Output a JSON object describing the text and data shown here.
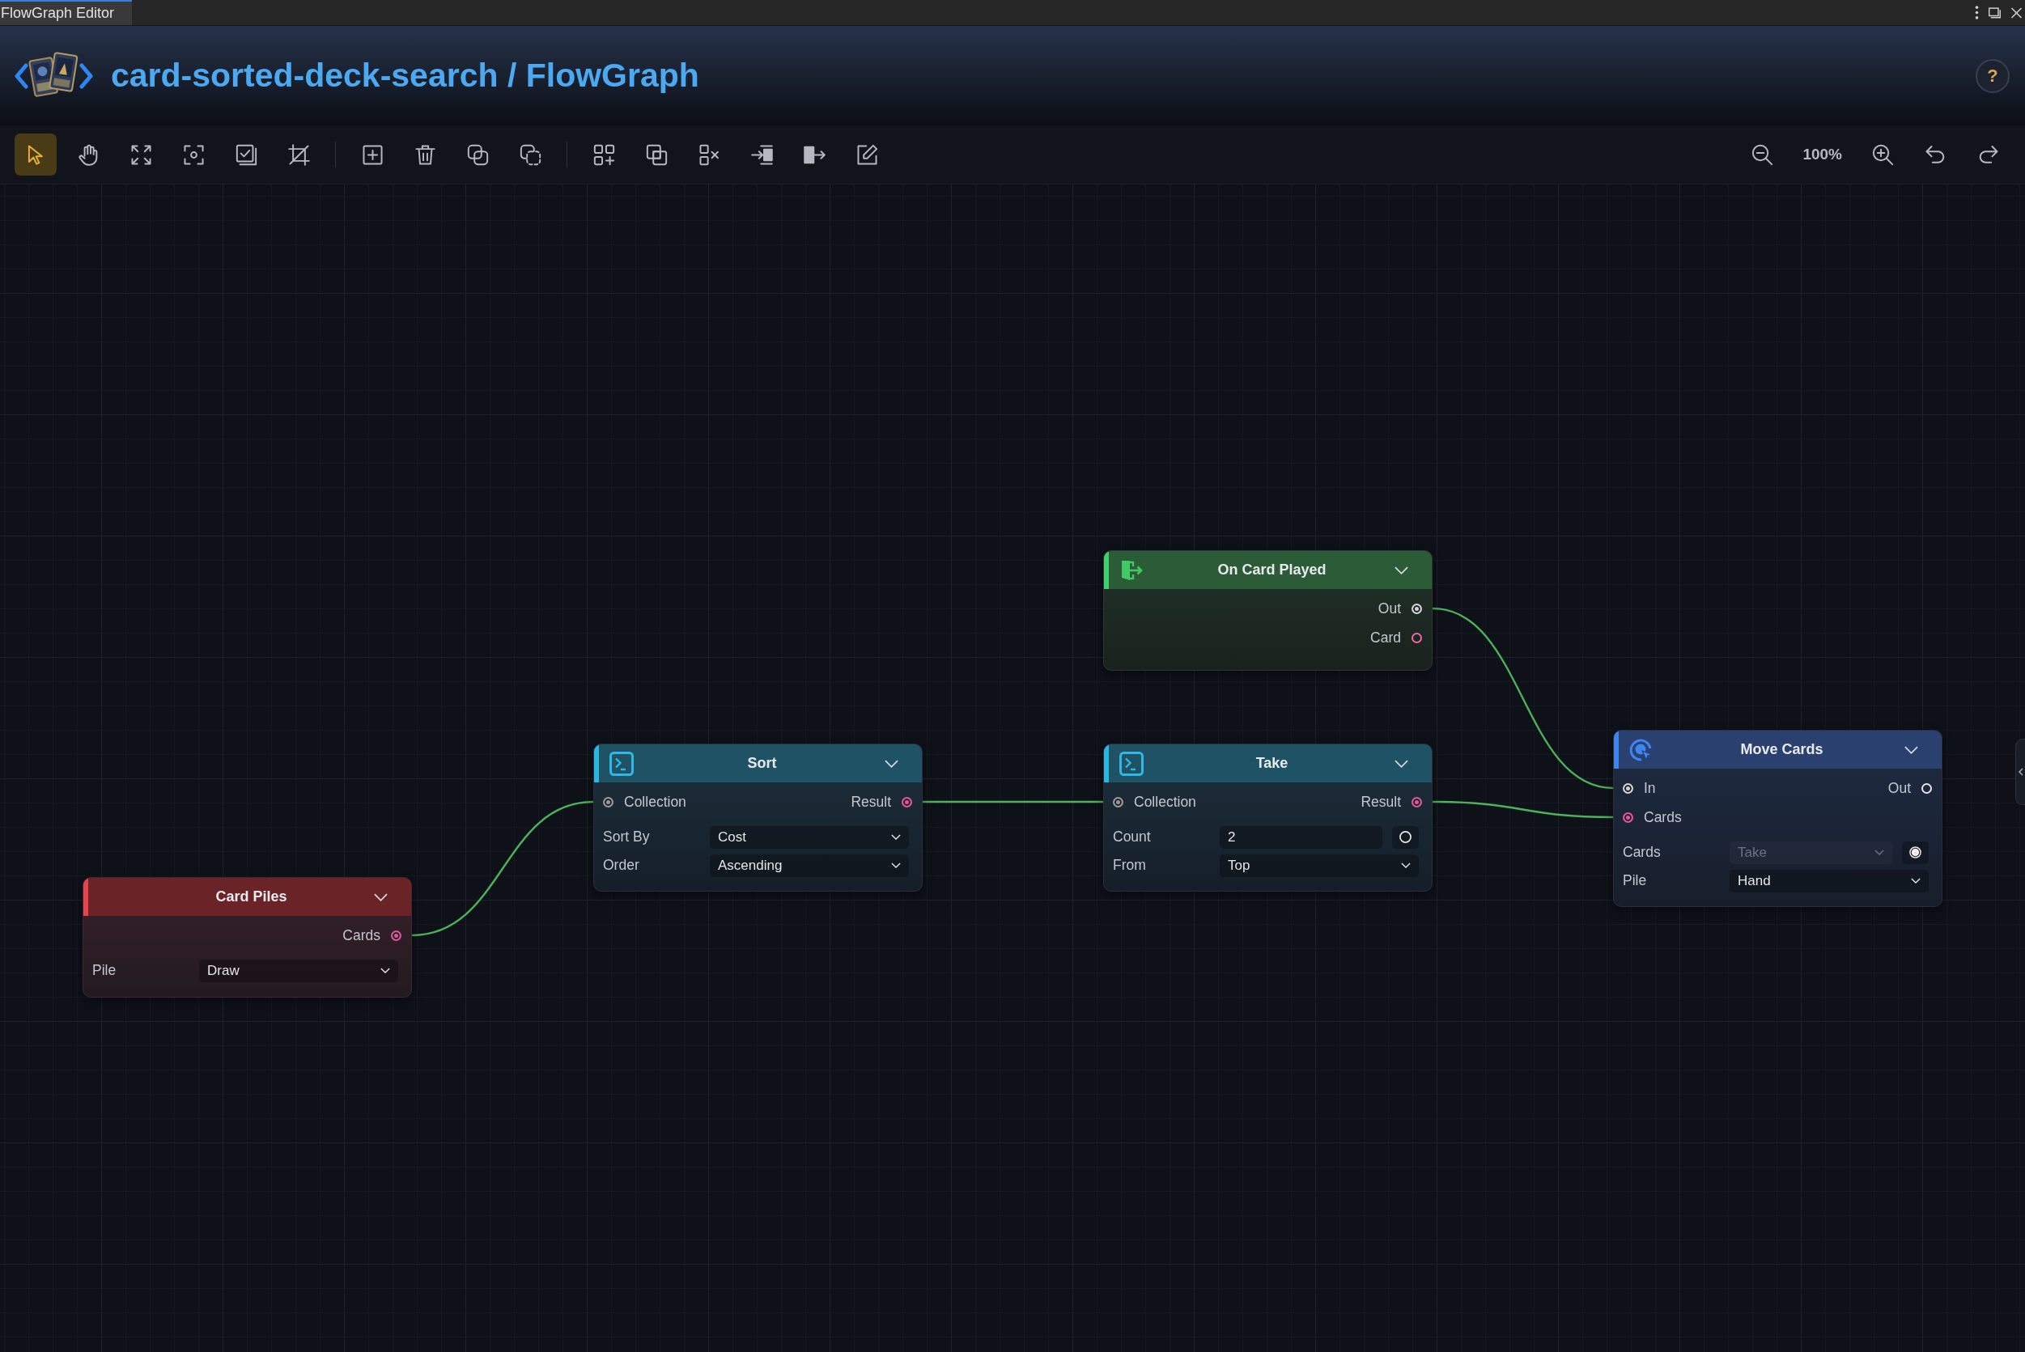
{
  "window": {
    "tab": {
      "label": "FlowGraph Editor",
      "selected": true
    }
  },
  "header": {
    "title": "card-sorted-deck-search / FlowGraph",
    "help": "?"
  },
  "toolbar": {
    "tools": [
      {
        "kind": "select",
        "selected": true
      },
      {
        "kind": "pan",
        "selected": false
      },
      {
        "kind": "fit",
        "selected": false
      },
      {
        "kind": "focus",
        "selected": false
      },
      {
        "kind": "select_all",
        "selected": false
      },
      {
        "kind": "crop",
        "selected": false
      }
    ],
    "edit_actions": [
      {
        "kind": "add"
      },
      {
        "kind": "delete"
      },
      {
        "kind": "duplicate"
      },
      {
        "kind": "copy"
      }
    ],
    "arrange_actions": [
      {
        "kind": "group"
      },
      {
        "kind": "nest"
      },
      {
        "kind": "ungroup"
      },
      {
        "kind": "pull_in"
      },
      {
        "kind": "push_out"
      },
      {
        "kind": "edit"
      }
    ],
    "zoom": "100%"
  },
  "graph": {
    "nodes": [
      {
        "kind": "event",
        "title": "On Card Played",
        "outputs": [
          {
            "label": "Out",
            "color": "#d4d4d4",
            "connected": true
          },
          {
            "label": "Card",
            "color": "#f06aa8",
            "connected": false
          }
        ]
      },
      {
        "kind": "function",
        "title": "Sort",
        "inputs": [
          {
            "label": "Collection",
            "color": "#9a9a9a",
            "connected": true
          }
        ],
        "outputs": [
          {
            "label": "Result",
            "color": "#e0579b",
            "connected": true
          }
        ],
        "fields": [
          {
            "label": "Sort By",
            "kind": "dropdown",
            "value": "Cost",
            "disabled": false
          },
          {
            "label": "Order",
            "kind": "dropdown",
            "value": "Ascending",
            "disabled": false
          }
        ]
      },
      {
        "kind": "function",
        "title": "Take",
        "inputs": [
          {
            "label": "Collection",
            "color": "#9a9a9a",
            "connected": true
          }
        ],
        "outputs": [
          {
            "label": "Result",
            "color": "#e0579b",
            "connected": true
          }
        ],
        "fields": [
          {
            "label": "Count",
            "kind": "number",
            "value": "2",
            "disabled": false,
            "port": {
              "connected": false
            }
          },
          {
            "label": "From",
            "kind": "dropdown",
            "value": "Top",
            "disabled": false
          }
        ]
      },
      {
        "kind": "action",
        "title": "Move Cards",
        "inputs": [
          {
            "label": "In",
            "color": "#d4d4d4",
            "connected": true
          },
          {
            "label": "Cards",
            "color": "#e0579b",
            "connected": true
          }
        ],
        "outputs": [
          {
            "label": "Out",
            "color": "#e6e6e6",
            "connected": false
          }
        ],
        "fields": [
          {
            "label": "Cards",
            "kind": "dropdown",
            "value": "Take",
            "disabled": true,
            "port": {
              "connected": true
            }
          },
          {
            "label": "Pile",
            "kind": "dropdown",
            "value": "Hand",
            "disabled": false
          }
        ]
      },
      {
        "kind": "source",
        "title": "Card Piles",
        "outputs": [
          {
            "label": "Cards",
            "color": "#e0579b",
            "connected": true
          }
        ],
        "fields": [
          {
            "label": "Pile",
            "kind": "dropdown",
            "value": "Draw",
            "disabled": false
          }
        ]
      }
    ]
  }
}
